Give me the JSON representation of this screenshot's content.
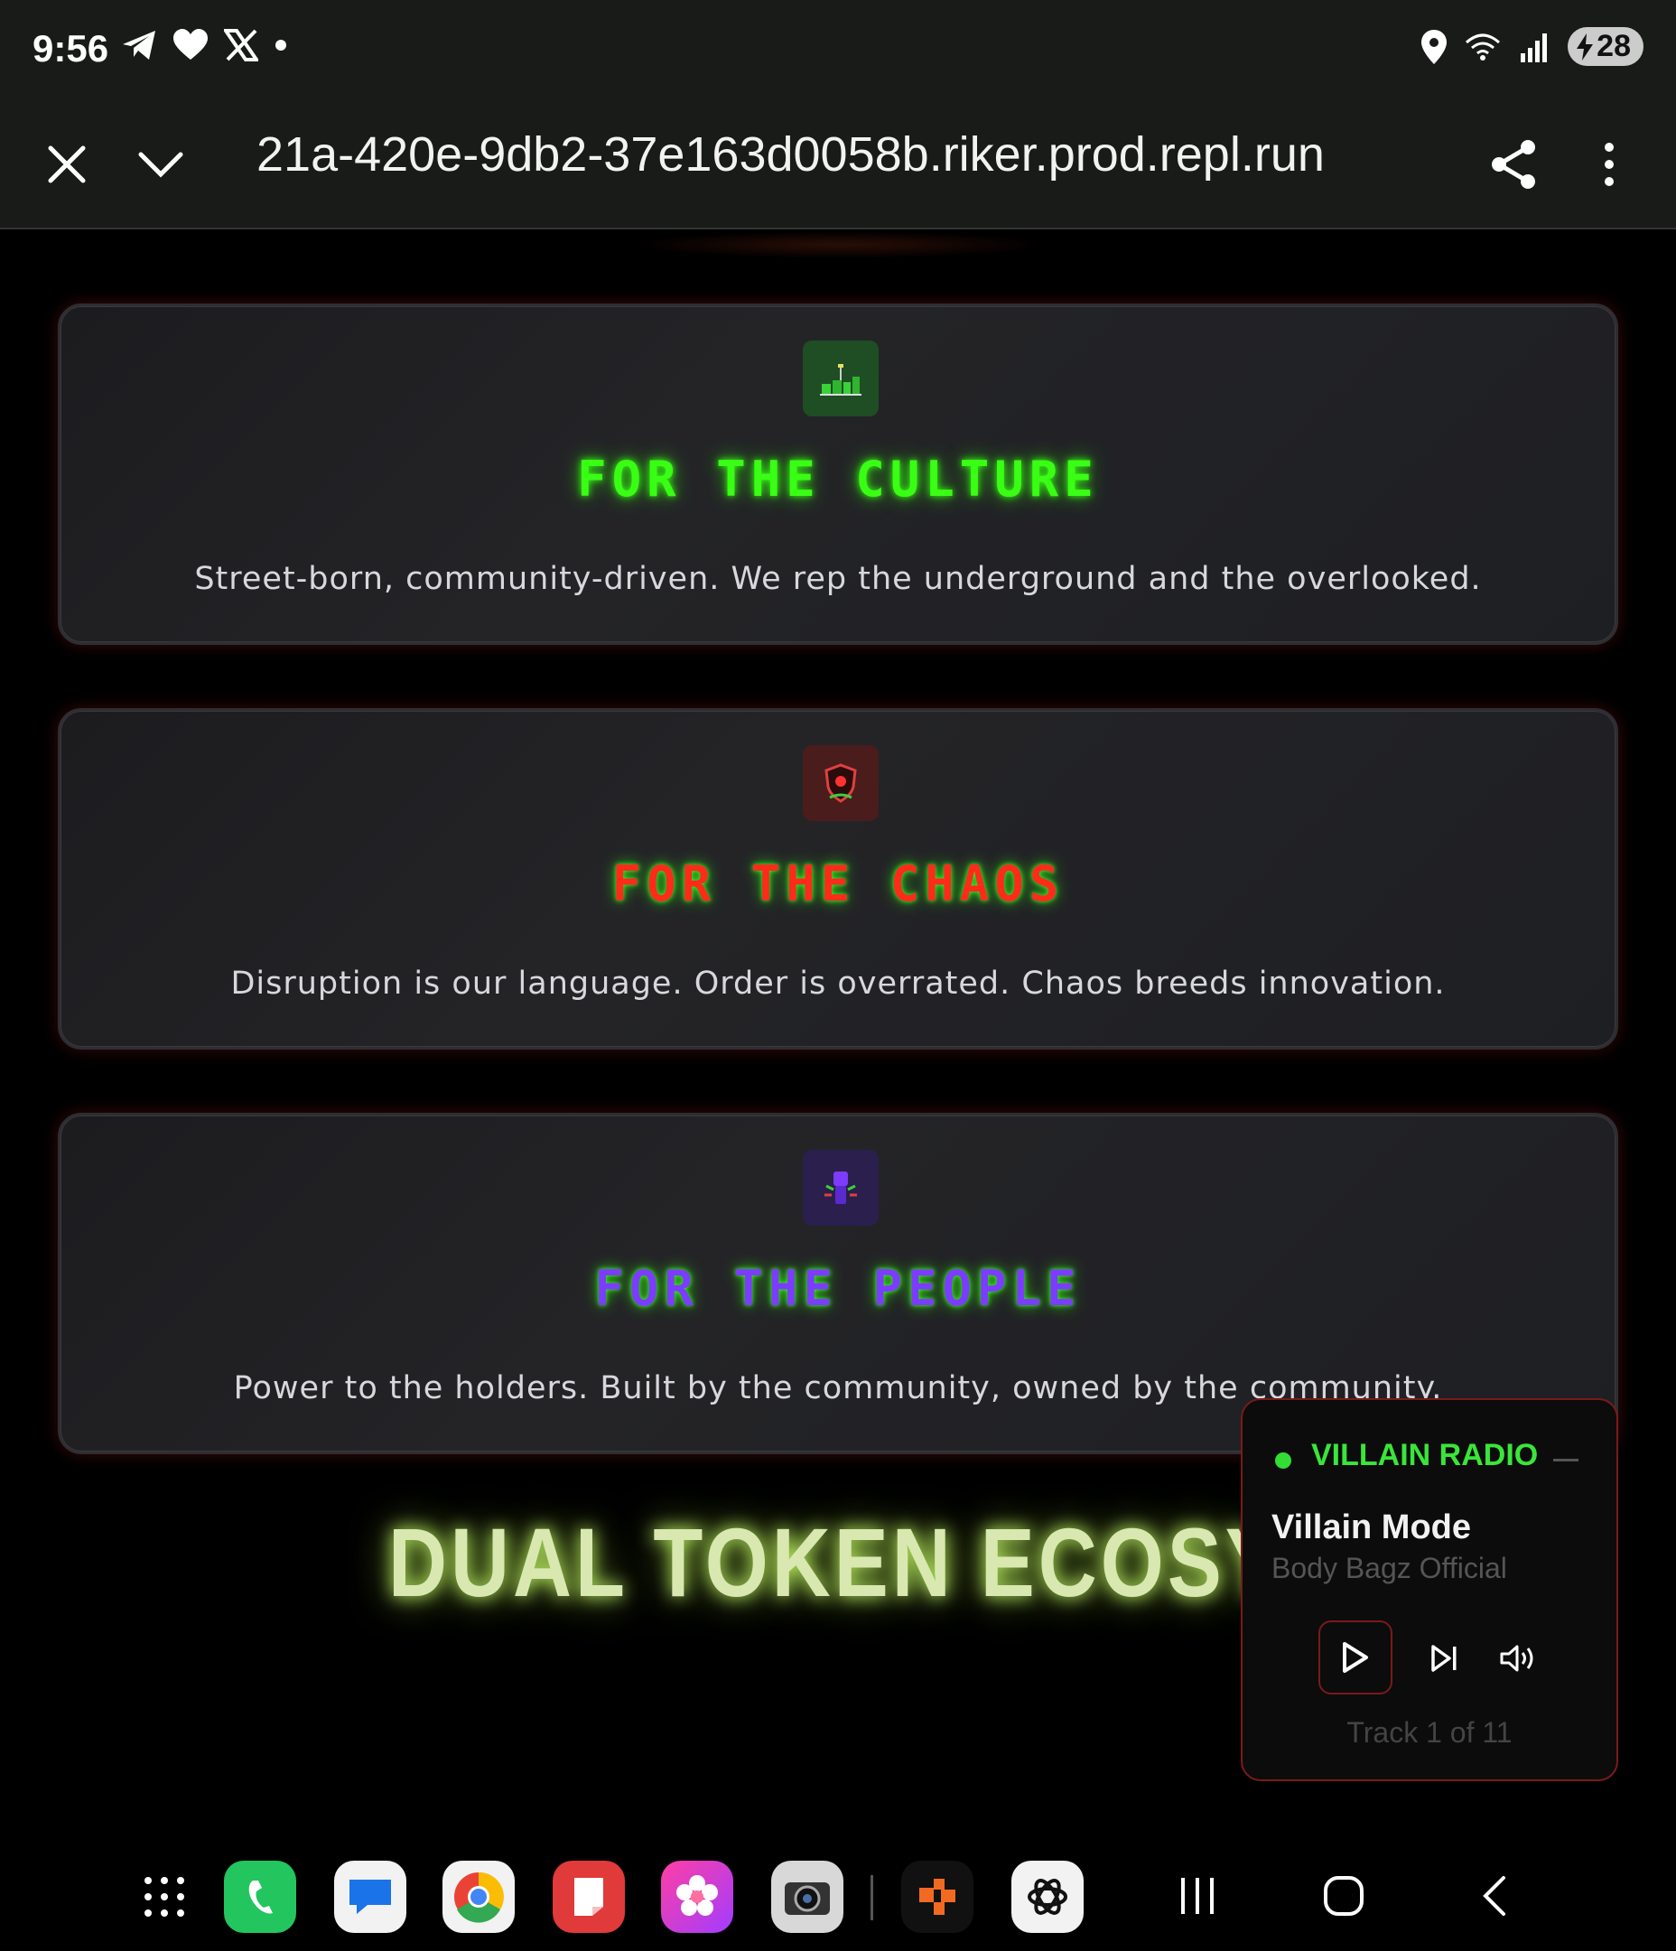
{
  "status_bar": {
    "time": "9:56",
    "battery": "28",
    "left_icons": [
      "telegram-icon",
      "heart-icon",
      "x-icon",
      "dot-icon"
    ],
    "right_icons": [
      "location-icon",
      "wifi-icon",
      "signal-icon",
      "battery-icon"
    ]
  },
  "browser": {
    "url": "21a-420e-9db2-37e163d0058b.riker.prod.repl.run"
  },
  "cards": [
    {
      "title": "FOR THE CULTURE",
      "description": "Street-born, community-driven. We rep the underground and the overlooked.",
      "icon": "skyline-icon",
      "icon_bg": "#1f4d24",
      "title_color": "#39ff14"
    },
    {
      "title": "FOR THE CHAOS",
      "description": "Disruption is our language. Order is overrated. Chaos breeds innovation.",
      "icon": "shield-icon",
      "icon_bg": "#4a1c1c",
      "title_color": "#ff2a1a"
    },
    {
      "title": "FOR THE PEOPLE",
      "description": "Power to the holders. Built by the community, owned by the community.",
      "icon": "raised-fist-icon",
      "icon_bg": "#2a1f4d",
      "title_color": "#7b3cff"
    }
  ],
  "headline": "DUAL TOKEN ECOSYSTEM",
  "radio": {
    "title": "VILLAIN RADIO",
    "song": "Villain Mode",
    "artist": "Body Bagz Official",
    "track": "Track 1 of 11",
    "accent": "#39e639"
  },
  "dock": {
    "apps": [
      "app-drawer-icon",
      "phone-icon",
      "messages-icon",
      "chrome-icon",
      "notes-icon",
      "gallery-icon",
      "camera-icon",
      "office-icon",
      "chatgpt-icon"
    ],
    "nav": [
      "recents-icon",
      "home-icon",
      "back-icon"
    ]
  }
}
